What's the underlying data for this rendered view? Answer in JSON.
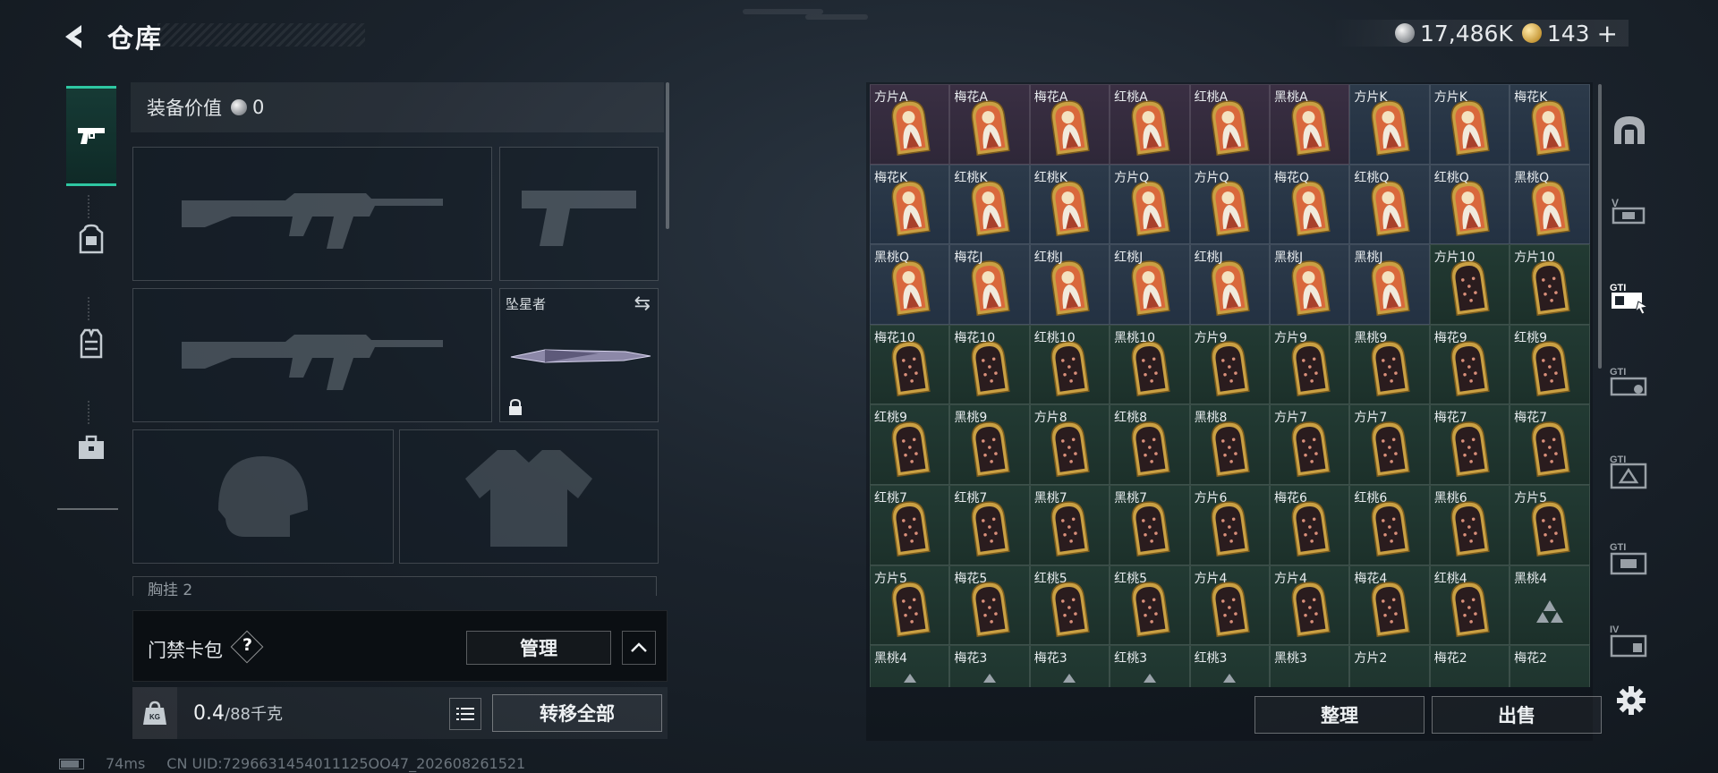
{
  "header": {
    "title": "仓库",
    "currencies": [
      {
        "icon": "silver-coin-icon",
        "value": "17,486K"
      },
      {
        "icon": "gold-coin-icon",
        "value": "143"
      }
    ],
    "plus": "+"
  },
  "left_tabs": [
    {
      "icon": "pistol-icon",
      "active": true
    },
    {
      "icon": "backpack-icon",
      "active": false
    },
    {
      "icon": "vest-icon",
      "active": false
    },
    {
      "icon": "toolbox-icon",
      "active": false
    }
  ],
  "equipment": {
    "value_label": "装备价值",
    "value": "0",
    "melee_name": "坠星者",
    "chest_label": "胸挂",
    "chest_count": "2"
  },
  "access_card": {
    "label": "门禁卡包",
    "help": "?",
    "manage_label": "管理"
  },
  "weight": {
    "current": "0.4",
    "max": "/88千克",
    "icon_text": "KG",
    "transfer_label": "转移全部"
  },
  "status": {
    "ping": "74ms",
    "uid": "CN UID:7296631454011125OO47_202608261521"
  },
  "storage": {
    "cells": [
      {
        "label": "方片A",
        "kind": "face",
        "tint": "purple"
      },
      {
        "label": "梅花A",
        "kind": "face",
        "tint": "purple"
      },
      {
        "label": "梅花A",
        "kind": "face",
        "tint": "purple"
      },
      {
        "label": "红桃A",
        "kind": "face",
        "tint": "purple"
      },
      {
        "label": "红桃A",
        "kind": "face",
        "tint": "purple"
      },
      {
        "label": "黑桃A",
        "kind": "face",
        "tint": "purple"
      },
      {
        "label": "方片K",
        "kind": "face",
        "tint": "blue"
      },
      {
        "label": "方片K",
        "kind": "face",
        "tint": "blue"
      },
      {
        "label": "梅花K",
        "kind": "face",
        "tint": "blue"
      },
      {
        "label": "梅花K",
        "kind": "face",
        "tint": "blue"
      },
      {
        "label": "红桃K",
        "kind": "face",
        "tint": "blue"
      },
      {
        "label": "红桃K",
        "kind": "face",
        "tint": "blue"
      },
      {
        "label": "方片Q",
        "kind": "face",
        "tint": "blue"
      },
      {
        "label": "方片Q",
        "kind": "face",
        "tint": "blue"
      },
      {
        "label": "梅花Q",
        "kind": "face",
        "tint": "blue"
      },
      {
        "label": "红桃Q",
        "kind": "face",
        "tint": "blue"
      },
      {
        "label": "红桃Q",
        "kind": "face",
        "tint": "blue"
      },
      {
        "label": "黑桃Q",
        "kind": "face",
        "tint": "blue"
      },
      {
        "label": "黑桃Q",
        "kind": "face",
        "tint": "blue"
      },
      {
        "label": "梅花J",
        "kind": "face",
        "tint": "blue"
      },
      {
        "label": "红桃J",
        "kind": "face",
        "tint": "blue"
      },
      {
        "label": "红桃J",
        "kind": "face",
        "tint": "blue"
      },
      {
        "label": "红桃J",
        "kind": "face",
        "tint": "blue"
      },
      {
        "label": "黑桃J",
        "kind": "face",
        "tint": "blue"
      },
      {
        "label": "黑桃J",
        "kind": "face",
        "tint": "blue"
      },
      {
        "label": "方片10",
        "kind": "num"
      },
      {
        "label": "方片10",
        "kind": "num"
      },
      {
        "label": "梅花10",
        "kind": "num"
      },
      {
        "label": "梅花10",
        "kind": "num"
      },
      {
        "label": "红桃10",
        "kind": "num"
      },
      {
        "label": "黑桃10",
        "kind": "num"
      },
      {
        "label": "方片9",
        "kind": "num"
      },
      {
        "label": "方片9",
        "kind": "num"
      },
      {
        "label": "黑桃9",
        "kind": "num"
      },
      {
        "label": "梅花9",
        "kind": "num"
      },
      {
        "label": "红桃9",
        "kind": "num"
      },
      {
        "label": "红桃9",
        "kind": "num"
      },
      {
        "label": "黑桃9",
        "kind": "num"
      },
      {
        "label": "方片8",
        "kind": "num"
      },
      {
        "label": "红桃8",
        "kind": "num"
      },
      {
        "label": "黑桃8",
        "kind": "num"
      },
      {
        "label": "方片7",
        "kind": "num"
      },
      {
        "label": "方片7",
        "kind": "num"
      },
      {
        "label": "梅花7",
        "kind": "num"
      },
      {
        "label": "梅花7",
        "kind": "num"
      },
      {
        "label": "红桃7",
        "kind": "num"
      },
      {
        "label": "红桃7",
        "kind": "num"
      },
      {
        "label": "黑桃7",
        "kind": "num"
      },
      {
        "label": "黑桃7",
        "kind": "num"
      },
      {
        "label": "方片6",
        "kind": "num"
      },
      {
        "label": "梅花6",
        "kind": "num"
      },
      {
        "label": "红桃6",
        "kind": "num"
      },
      {
        "label": "黑桃6",
        "kind": "num"
      },
      {
        "label": "方片5",
        "kind": "num"
      },
      {
        "label": "方片5",
        "kind": "num"
      },
      {
        "label": "梅花5",
        "kind": "num"
      },
      {
        "label": "红桃5",
        "kind": "num"
      },
      {
        "label": "红桃5",
        "kind": "num"
      },
      {
        "label": "方片4",
        "kind": "num"
      },
      {
        "label": "方片4",
        "kind": "num"
      },
      {
        "label": "梅花4",
        "kind": "num"
      },
      {
        "label": "红桃4",
        "kind": "num"
      },
      {
        "label": "黑桃4",
        "kind": "warn"
      },
      {
        "label": "黑桃4",
        "kind": "partial"
      },
      {
        "label": "梅花3",
        "kind": "partial"
      },
      {
        "label": "梅花3",
        "kind": "partial"
      },
      {
        "label": "红桃3",
        "kind": "partial"
      },
      {
        "label": "红桃3",
        "kind": "partial"
      },
      {
        "label": "黑桃3",
        "kind": "partial-empty"
      },
      {
        "label": "方片2",
        "kind": "partial-empty"
      },
      {
        "label": "梅花2",
        "kind": "partial-empty"
      },
      {
        "label": "梅花2",
        "kind": "partial-empty"
      }
    ],
    "sort_label": "整理",
    "sell_label": "出售"
  },
  "right_tabs": [
    {
      "icon": "arch-icon"
    },
    {
      "icon": "v-case-icon"
    },
    {
      "icon": "gti-card-icon",
      "active": true
    },
    {
      "icon": "gti-box-icon"
    },
    {
      "icon": "gti-pack-icon"
    },
    {
      "icon": "gti-crate-icon"
    },
    {
      "icon": "iv-case-icon"
    }
  ],
  "colors": {
    "accent": "#2ec7a2",
    "face_cell": "#2c3a4a",
    "ace_cell": "#3a2f43",
    "number_cell": "#223a33",
    "card_gold": "#c9a043"
  }
}
